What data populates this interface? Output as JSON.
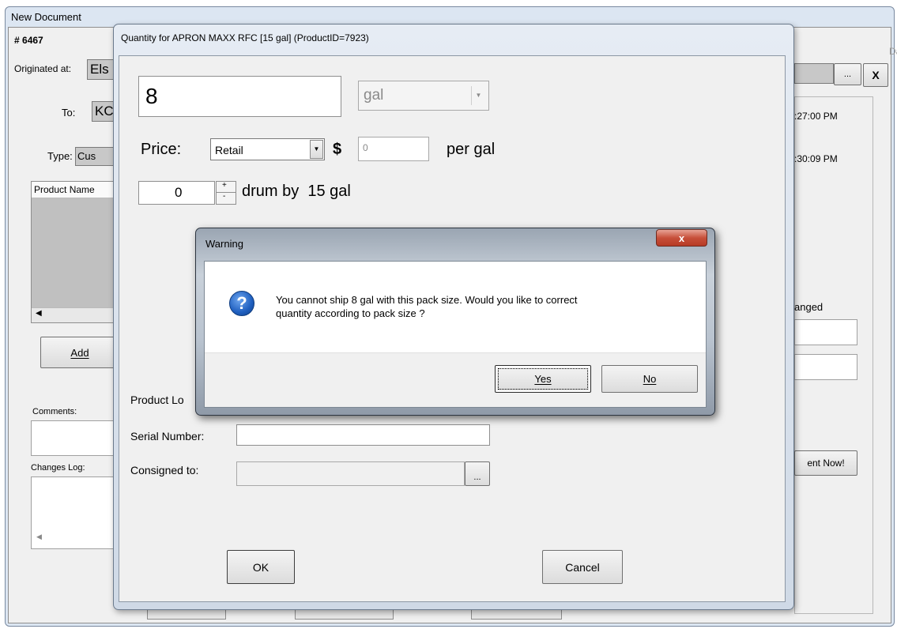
{
  "background_window": {
    "title": "New Document",
    "doc_number_prefix": "#",
    "doc_number": "6467",
    "originated_at_label": "Originated at:",
    "originated_at_value": "Els",
    "to_label": "To:",
    "to_value": "KC",
    "type_label": "Type:",
    "type_value": "Cus",
    "product_name_header": "Product Name",
    "add_button": "Add",
    "comments_label": "Comments:",
    "changes_log_label": "Changes Log:",
    "date_header": "Date",
    "time1": ":27:00 PM",
    "time2": ":30:09 PM",
    "changed_label": "anged",
    "browse_button": "...",
    "close_button": "X",
    "action_button": "ent Now!"
  },
  "quantity_dialog": {
    "title": "Quantity for APRON MAXX RFC  [15 gal] (ProductID=7923)",
    "quantity_value": "8",
    "unit_value": "gal",
    "price_label": "Price:",
    "price_type": "Retail",
    "currency": "$",
    "price_value": "0",
    "per_unit": "per gal",
    "pack_count": "0",
    "pack_text": "drum by  15 gal",
    "product_lot_label": "Product Lo",
    "serial_label": "Serial Number:",
    "serial_value": "",
    "consigned_label": "Consigned to:",
    "consigned_value": "",
    "browse_button": "...",
    "ok_button": "OK",
    "cancel_button": "Cancel"
  },
  "warning_dialog": {
    "title": "Warning",
    "close_glyph": "x",
    "message_line1": "You cannot ship 8 gal with this pack size. Would you like to correct",
    "message_line2": "quantity according to pack size ?",
    "icon_glyph": "?",
    "yes_button": "Yes",
    "no_button": "No"
  },
  "colors": {
    "dialog_chrome": "#cfd9e6",
    "client_bg": "#f0f0f0",
    "question_icon": "#1f5fbf",
    "close_button": "#c7503a"
  }
}
